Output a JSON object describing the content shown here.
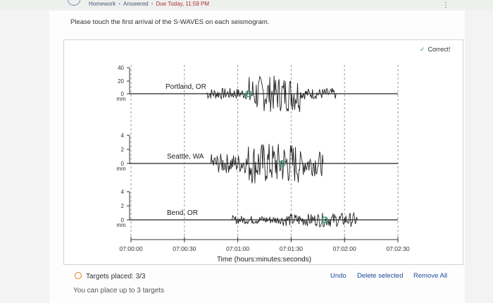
{
  "topbar": {
    "back_icon": "circle-back-icon",
    "crumbs": [
      "Homework",
      "Answered",
      "Due Today, 11:59 PM"
    ],
    "menu_icon": "vertical-dots-icon"
  },
  "instructions": "Please touch the first arrival of the S-WAVES on each seismogram.",
  "feedback": {
    "text": "Correct!",
    "icon": "checkmark-icon",
    "color": "#3a9a3a"
  },
  "chart_data": {
    "type": "line",
    "xlabel": "Time (hours:minutes:seconds)",
    "x_ticks": [
      "07:00:00",
      "07:00:30",
      "07:01:00",
      "07:01:30",
      "07:02:00",
      "07:02:30"
    ],
    "xlim_seconds": [
      0,
      150
    ],
    "unit_label": "mm",
    "traces": [
      {
        "station": "Portland, OR",
        "y_ticks": [
          "40",
          "20",
          "0"
        ],
        "marker_seconds": 66,
        "marker_color": "#3aa37a"
      },
      {
        "station": "Seattle, WA",
        "y_ticks": [
          "4",
          "2",
          "0"
        ],
        "marker_seconds": 85,
        "marker_color": "#3aa37a"
      },
      {
        "station": "Bend, OR",
        "y_ticks": [
          "4",
          "2",
          "0"
        ],
        "marker_seconds": 109,
        "marker_color": "#3aa37a"
      }
    ]
  },
  "status": {
    "targets_placed": "Targets placed: 3/3",
    "capacity": "You can place up to 3 targets"
  },
  "actions": {
    "undo": "Undo",
    "delete_selected": "Delete selected",
    "remove_all": "Remove All"
  },
  "colors": {
    "accent": "#e07b1a",
    "link": "#1a4a9a"
  }
}
